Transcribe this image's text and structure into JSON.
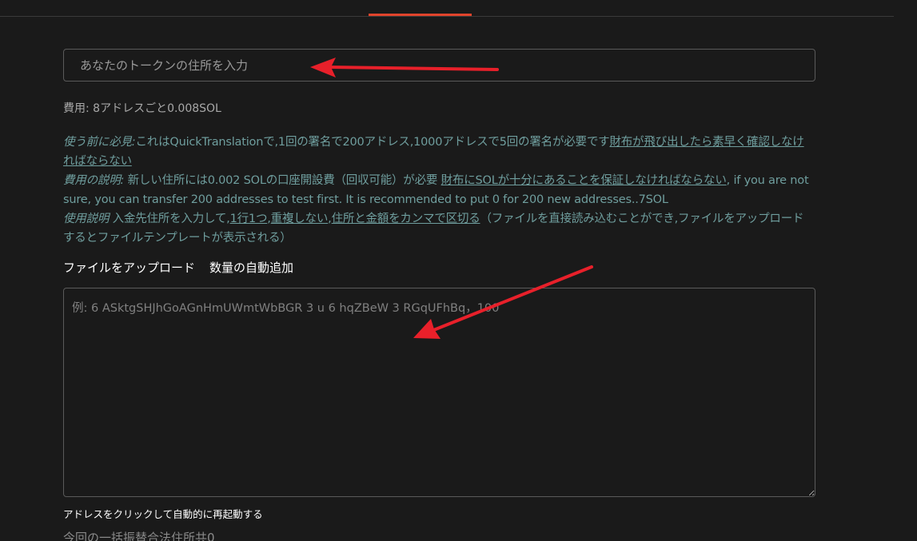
{
  "token_address": {
    "placeholder": "あなたのトークンの住所を入力",
    "value": ""
  },
  "fee_text": "費用: 8アドレスごと0.008SOL",
  "notice": {
    "before_use_label": "使う前に必見:",
    "before_use_text": "これはQuickTranslationで,1回の署名で200アドレス,1000アドレスで5回の署名が必要です",
    "before_use_link": "財布が飛び出したら素早く確認しなければならない",
    "fee_label": "費用の説明:",
    "fee_text": " 新しい住所には0.002 SOLの口座開設費（回収可能）が必要 ",
    "fee_link": "財布にSOLが十分にあることを保証しなければならない",
    "fee_tail": ", if you are not sure, you can transfer 200 addresses to test first. It is recommended to put 0 for 200 new addresses..7SOL",
    "usage_label": "使用説明",
    "usage_text": " 入金先住所を入力して,",
    "usage_link1": "1行1つ",
    "usage_sep1": ",",
    "usage_link2": "重複しない",
    "usage_sep2": ",",
    "usage_link3": "住所と金額をカンマで区切る",
    "usage_tail": "（ファイルを直接読み込むことができ,ファイルをアップロードするとファイルテンプレートが表示される）"
  },
  "actions": {
    "upload_file": "ファイルをアップロード",
    "auto_add_quantity": "数量の自動追加"
  },
  "addresses": {
    "placeholder": "例: 6 ASktgSHJhGoAGnHmUWmtWbBGR 3 u 6 hqZBeW 3 RGqUFhBq，100",
    "value": ""
  },
  "restart_text": "アドレスをクリックして自動的に再起動する",
  "valid_count_text": "今回の一括振替合法住所共0",
  "colors": {
    "background": "#1a1a1a",
    "accent": "#e0442c",
    "notice_text": "#6f9e9e",
    "annotation_arrow": "#e8202a"
  }
}
